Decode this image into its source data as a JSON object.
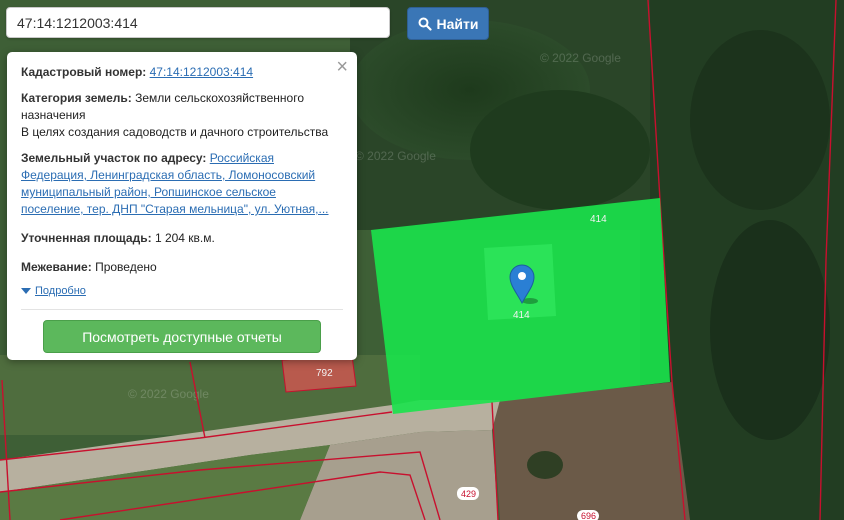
{
  "search": {
    "value": "47:14:1212003:414",
    "button_label": "Найти",
    "button_icon": "search-icon"
  },
  "map": {
    "watermark": "© 2022 Google",
    "labels": {
      "selected_top": "414",
      "selected_center": "414",
      "plot_792": "792",
      "plot_429": "429",
      "plot_696": "696"
    },
    "colors": {
      "selected_fill": "#19e34b",
      "boundary": "#c8102e",
      "plot_792_fill": "#b85a4d",
      "marker": "#2a7fd4"
    }
  },
  "popup": {
    "cadastral_label": "Кадастровый номер:",
    "cadastral_value": "47:14:1212003:414",
    "category_label": "Категория земель:",
    "category_value_1": "Земли сельскохозяйственного",
    "category_value_2": "назначения",
    "category_value_3": "В целях создания садоводств и дачного строительства",
    "address_label": "Земельный участок по адресу:",
    "address_line_1": "Российская",
    "address_line_2": "Федерация, Ленинградская область, Ломоносовский",
    "address_line_3": "муниципальный район, Ропшинское сельское",
    "address_line_4": "поселение, тер. ДНП \"Старая мельница\", ул. Уютная,...",
    "area_label": "Уточненная площадь:",
    "area_value": "1 204 кв.м.",
    "survey_label": "Межевание:",
    "survey_value": "Проведено",
    "more_label": "Подробно",
    "report_button": "Посмотреть доступные отчеты",
    "close_symbol": "×"
  }
}
